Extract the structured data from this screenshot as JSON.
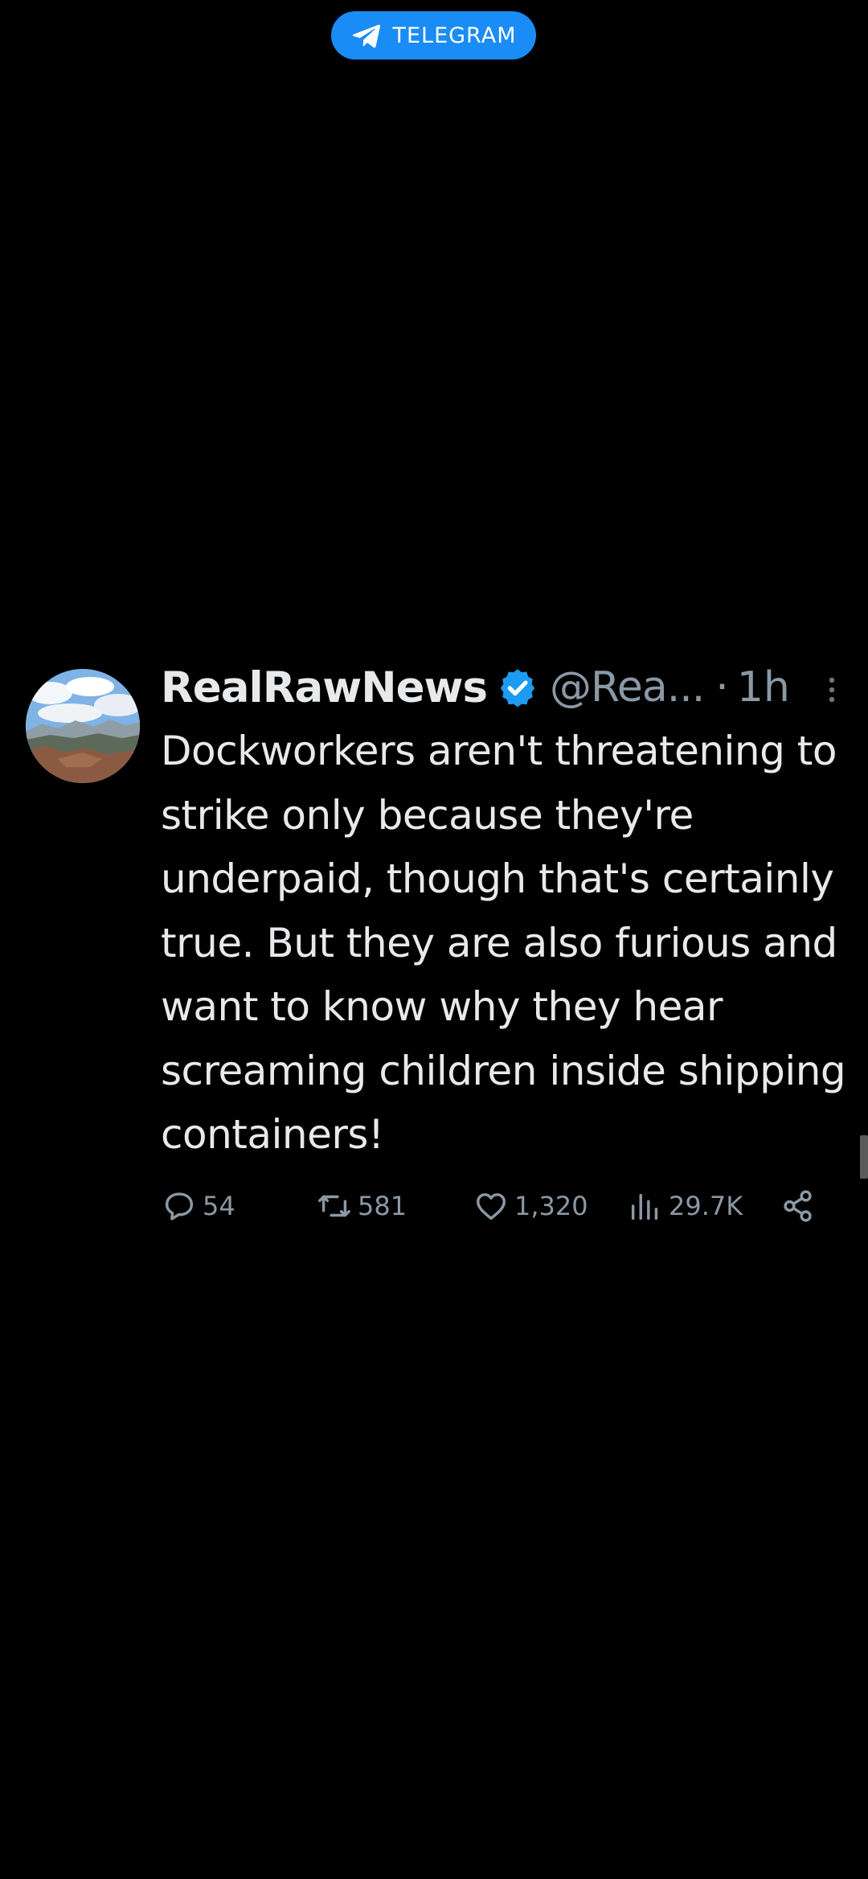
{
  "telegram_badge": {
    "label": "TELEGRAM",
    "color": "#1a8cf5",
    "icon": "telegram-plane-icon"
  },
  "tweet": {
    "display_name": "RealRawNews",
    "verified": true,
    "handle": "@Rea...",
    "separator": "·",
    "time": "1h",
    "text": "Dockworkers aren't threatening to strike only because they're underpaid, though that's certainly true. But they are also furious and want to know why they hear screaming children inside shipping containers!",
    "avatar_icon": "mountain-landscape-avatar",
    "actions": {
      "replies": "54",
      "retweets": "581",
      "likes": "1,320",
      "views": "29.7K"
    }
  },
  "colors": {
    "background": "#000000",
    "text_primary": "#e7e9ea",
    "text_secondary": "#8b98a5",
    "verified_blue": "#1d9bf0"
  }
}
